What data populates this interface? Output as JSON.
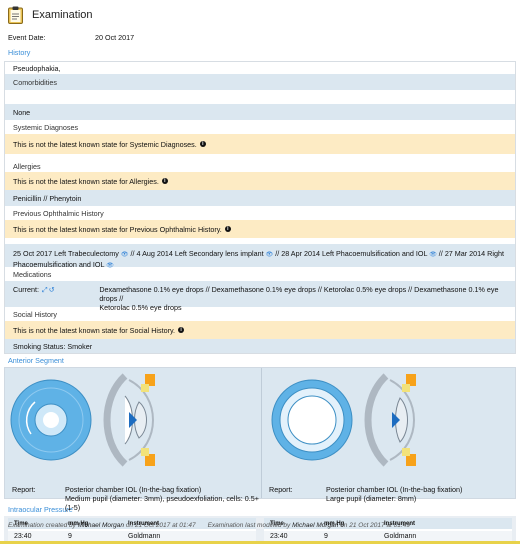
{
  "header": {
    "title": "Examination",
    "icon": "clipboard-icon"
  },
  "event": {
    "label": "Event Date:",
    "value": "20 Oct 2017"
  },
  "history": {
    "section_label": "History",
    "main_text": "Pseudophakia,",
    "comorbidities": {
      "title": "Comorbidities",
      "value": "None"
    },
    "systemic": {
      "title": "Systemic Diagnoses",
      "warning": "This is not the latest known state for Systemic Diagnoses."
    },
    "allergies": {
      "title": "Allergies",
      "warning": "This is not the latest known state for Allergies.",
      "value": "Penicillin // Phenytoin"
    },
    "ophthalmic": {
      "title": "Previous Ophthalmic History",
      "warning": "This is not the latest known state for Previous Ophthalmic History.",
      "items": [
        {
          "text": "25 Oct 2017 Left Trabeculectomy",
          "sep": " // "
        },
        {
          "text": "4 Aug 2014 Left Secondary lens implant",
          "sep": " // "
        },
        {
          "text": "28 Apr 2014 Left Phacoemulsification and IOL",
          "sep": " // "
        },
        {
          "text": "27 Mar 2014 Right Phacoemulsification and IOL",
          "sep": ""
        }
      ]
    },
    "medications": {
      "title": "Medications",
      "current_label": "Current:",
      "list_line1": "Dexamethasone 0.1% eye drops // Dexamethasone 0.1% eye drops // Ketorolac 0.5% eye drops // Dexamethasone 0.1% eye drops //",
      "list_line2": "Ketorolac 0.5% eye drops"
    },
    "social": {
      "title": "Social History",
      "warning": "This is not the latest known state for Social History.",
      "value": "Smoking Status: Smoker"
    }
  },
  "anterior": {
    "section_label": "Anterior Segment",
    "right": {
      "report_label": "Report:",
      "line1": "Posterior chamber IOL (In-the-bag fixation)",
      "line2": "Medium pupil (diameter: 3mm), pseudoexfoliation, cells: 0.5+ (1-5)"
    },
    "left": {
      "report_label": "Report:",
      "line1": "Posterior chamber IOL (In-the-bag fixation)",
      "line2": "Large pupil (diameter: 8mm)"
    }
  },
  "iop": {
    "section_label": "Intraocular Pressure",
    "headers": [
      "Time",
      "mm Hg",
      "Instrument"
    ],
    "right": {
      "time": "23:40",
      "value": "9",
      "instrument": "Goldmann"
    },
    "left": {
      "time": "23:40",
      "value": "9",
      "instrument": "Goldmann"
    }
  },
  "footer": {
    "created_prefix": "Examination created by",
    "created_by": "Michael Morgan",
    "created_on": "on 21 Oct 2017 at 01:47",
    "modified_prefix": "Examination last modified by",
    "modified_by": "Michael Morgan",
    "modified_on": "on 21 Oct 2017 at 01:49"
  },
  "colors": {
    "link_blue": "#3b8fd8",
    "warning_bg": "#fdebc4",
    "row_blue": "#dbe7f0",
    "iris": "#5fb2e6"
  }
}
